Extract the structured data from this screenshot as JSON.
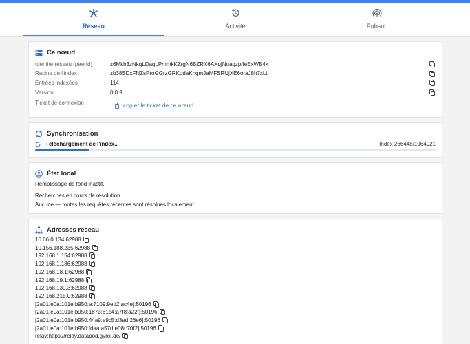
{
  "tabs": [
    {
      "label": "Réseau",
      "icon": "network-icon",
      "active": true
    },
    {
      "label": "Activité",
      "icon": "history-icon",
      "active": false
    },
    {
      "label": "Pubsub",
      "icon": "broadcast-icon",
      "active": false
    }
  ],
  "node": {
    "title": "Ce nœud",
    "rows": [
      {
        "key": "Identité réseau (peerId)",
        "value": "z6Mkh3zNkqLDaqLPmmkKZrgN6BZRX6AXqjNuagzp4eExWB4k"
      },
      {
        "key": "Racine de l'index",
        "value": "zb38SDxFNZsProGGrzGRKodaKhqmJaMFSRUjXE6oraJ8h7xLt"
      },
      {
        "key": "Entrées indexées",
        "value": "114"
      },
      {
        "key": "Version",
        "value": "0.0.9"
      }
    ],
    "ticket_label": "Ticket de connexion",
    "ticket_button": "copier le ticket de ce nœud"
  },
  "sync": {
    "title": "Synchronisation",
    "status": "Téléchargement de l'index...",
    "index_text": "Index 266448/1964021",
    "progress": 0.1357
  },
  "local": {
    "title": "État local",
    "backfill": "Remplissage de fond inactif.",
    "pending_title": "Recherches en cours de résolution",
    "pending_text": "Aucune — toutes les requêtes récentes sont résolues localement."
  },
  "addresses": {
    "title": "Adresses réseau",
    "items": [
      "10.66.0.134:62988",
      "10.156.188.235:62988",
      "192.168.1.154:62988",
      "192.168.1.186:62988",
      "192.168.18.1:62988",
      "192.168.19.1:62988",
      "192.168.139.3:62988",
      "192.168.215.0:62988",
      "[2a01:e0a:101e:b950:e:7109:9ed2:ac4e]:50196",
      "[2a01:e0a:101e:b950:1873:61c4:a7f8:a22f]:50196",
      "[2a01:e0a:101e:b950:44a9:e9c5:d3ad:26e6]:50196",
      "[2a01:e0a:101e:b950:fdaa:a57d:e08f:70f2]:50196",
      "relay:https://relay.datapod.gyroi.de/"
    ]
  },
  "colors": {
    "accent": "#3b82f6",
    "link": "#2d6fd6"
  }
}
